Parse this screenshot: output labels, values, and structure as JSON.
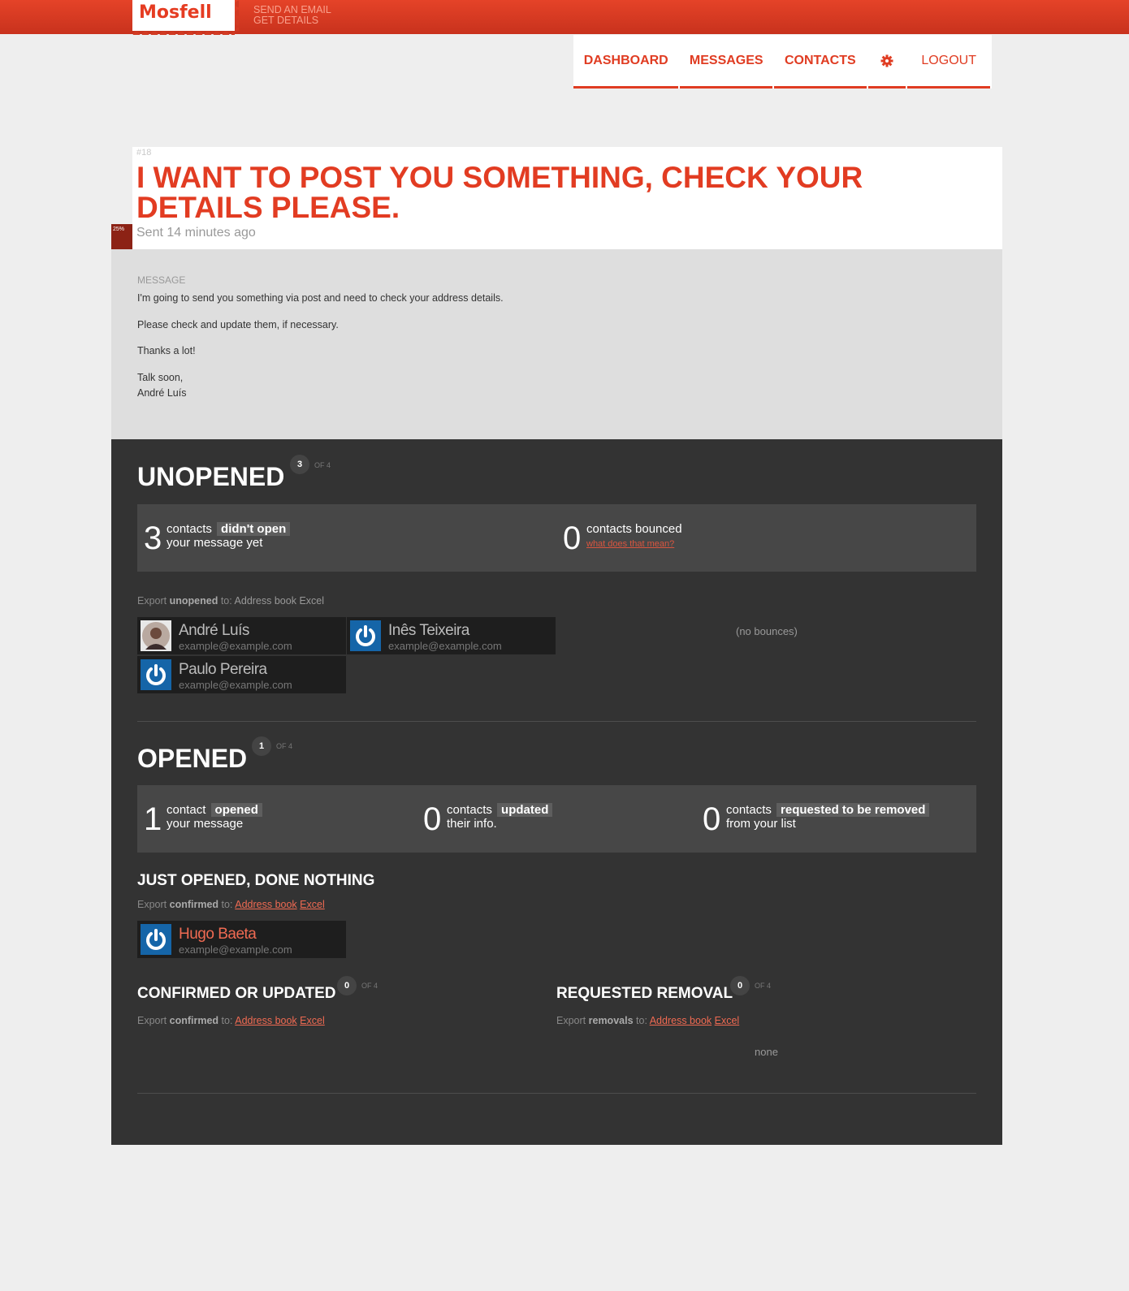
{
  "header": {
    "logo": "Mosfell",
    "links": [
      "SEND AN EMAIL",
      "GET DETAILS"
    ],
    "accent_color": "#e03c22"
  },
  "nav": {
    "items": [
      "DASHBOARD",
      "MESSAGES",
      "CONTACTS"
    ],
    "settings_icon": "gear-icon",
    "logout": "LOGOUT"
  },
  "message": {
    "number": "#18",
    "title": "I WANT TO POST YOU SOMETHING, CHECK YOUR DETAILS PLEASE.",
    "progress_label": "25%",
    "progress": 0.25,
    "sent": "Sent 14 minutes ago",
    "body_label": "MESSAGE",
    "paragraphs": [
      "I'm going to send you something via post and need to check your address details.",
      "Please check and update them, if necessary.",
      "Thanks a lot!",
      "Talk soon,",
      "André Luís"
    ]
  },
  "unopened": {
    "title": "UNOPENED",
    "count": "3",
    "of": "OF 4",
    "stat1": {
      "num": "3",
      "pre": "contacts",
      "hl": "didn't open",
      "line2": "your message yet"
    },
    "stat2": {
      "num": "0",
      "line1": "contacts bounced",
      "link": "what does that mean?"
    },
    "export": {
      "pre": "Export",
      "kind": "unopened",
      "to": "to:",
      "link1": "Address book",
      "link2": "Excel"
    },
    "contacts": [
      {
        "name": "André Luís",
        "email": "example@example.com",
        "avatar": "photo-avatar"
      },
      {
        "name": "Inês Teixeira",
        "email": "example@example.com",
        "avatar": "power-icon"
      },
      {
        "name": "Paulo Pereira",
        "email": "example@example.com",
        "avatar": "power-icon"
      }
    ],
    "no_bounces": "(no bounces)"
  },
  "opened": {
    "title": "OPENED",
    "count": "1",
    "of": "OF 4",
    "stat1": {
      "num": "1",
      "pre": "contact",
      "hl": "opened",
      "line2": "your message"
    },
    "stat2": {
      "num": "0",
      "pre": "contacts",
      "hl": "updated",
      "line2": "their info."
    },
    "stat3": {
      "num": "0",
      "pre": "contacts",
      "hl": "requested to be removed",
      "line2": "from your list"
    }
  },
  "just_opened": {
    "title": "JUST OPENED, DONE NOTHING",
    "export": {
      "pre": "Export",
      "kind": "confirmed",
      "to": "to:",
      "link1": "Address book",
      "link2": "Excel"
    },
    "contact": {
      "name": "Hugo Baeta",
      "email": "example@example.com",
      "avatar": "power-icon"
    }
  },
  "confirmed": {
    "title": "CONFIRMED OR UPDATED",
    "count": "0",
    "of": "OF 4",
    "export": {
      "pre": "Export",
      "kind": "confirmed",
      "to": "to:",
      "link1": "Address book",
      "link2": "Excel"
    }
  },
  "removal": {
    "title": "REQUESTED REMOVAL",
    "count": "0",
    "of": "OF 4",
    "export": {
      "pre": "Export",
      "kind": "removals",
      "to": "to:",
      "link1": "Address book",
      "link2": "Excel"
    },
    "none": "none"
  }
}
